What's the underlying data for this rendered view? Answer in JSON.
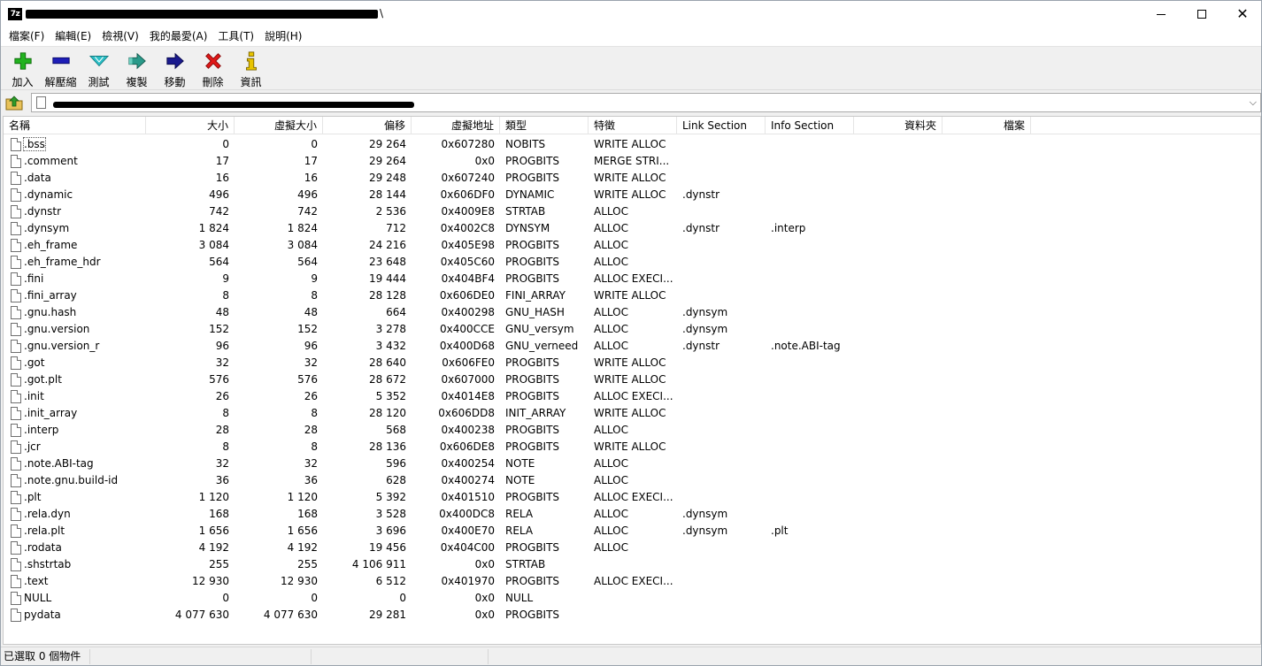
{
  "window": {
    "app_icon_text": "7z",
    "title_suffix": "\\"
  },
  "menu": [
    "檔案(F)",
    "編輯(E)",
    "檢視(V)",
    "我的最愛(A)",
    "工具(T)",
    "說明(H)"
  ],
  "toolbar": [
    {
      "id": "add",
      "label": "加入",
      "icon": "plus-icon",
      "color": "#22b21f"
    },
    {
      "id": "extract",
      "label": "解壓縮",
      "icon": "minus-icon",
      "color": "#1e1eb8"
    },
    {
      "id": "test",
      "label": "測試",
      "icon": "check-icon",
      "color": "#2bbfc6"
    },
    {
      "id": "copy",
      "label": "複製",
      "icon": "copy-arrow-icon",
      "color": "#2a9a8a"
    },
    {
      "id": "move",
      "label": "移動",
      "icon": "move-arrow-icon",
      "color": "#1a1a8e"
    },
    {
      "id": "delete",
      "label": "刪除",
      "icon": "delete-x-icon",
      "color": "#e01818"
    },
    {
      "id": "info",
      "label": "資訊",
      "icon": "info-icon",
      "color": "#c8a800"
    }
  ],
  "columns": [
    "名稱",
    "大小",
    "虛擬大小",
    "偏移",
    "虛擬地址",
    "類型",
    "特徵",
    "Link Section",
    "Info Section",
    "資料夾",
    "檔案"
  ],
  "rows": [
    [
      ".bss",
      "0",
      "0",
      "29 264",
      "0x607280",
      "NOBITS",
      "WRITE ALLOC",
      "",
      ""
    ],
    [
      ".comment",
      "17",
      "17",
      "29 264",
      "0x0",
      "PROGBITS",
      "MERGE STRI...",
      "",
      ""
    ],
    [
      ".data",
      "16",
      "16",
      "29 248",
      "0x607240",
      "PROGBITS",
      "WRITE ALLOC",
      "",
      ""
    ],
    [
      ".dynamic",
      "496",
      "496",
      "28 144",
      "0x606DF0",
      "DYNAMIC",
      "WRITE ALLOC",
      ".dynstr",
      ""
    ],
    [
      ".dynstr",
      "742",
      "742",
      "2 536",
      "0x4009E8",
      "STRTAB",
      "ALLOC",
      "",
      ""
    ],
    [
      ".dynsym",
      "1 824",
      "1 824",
      "712",
      "0x4002C8",
      "DYNSYM",
      "ALLOC",
      ".dynstr",
      ".interp"
    ],
    [
      ".eh_frame",
      "3 084",
      "3 084",
      "24 216",
      "0x405E98",
      "PROGBITS",
      "ALLOC",
      "",
      ""
    ],
    [
      ".eh_frame_hdr",
      "564",
      "564",
      "23 648",
      "0x405C60",
      "PROGBITS",
      "ALLOC",
      "",
      ""
    ],
    [
      ".fini",
      "9",
      "9",
      "19 444",
      "0x404BF4",
      "PROGBITS",
      "ALLOC EXECI...",
      "",
      ""
    ],
    [
      ".fini_array",
      "8",
      "8",
      "28 128",
      "0x606DE0",
      "FINI_ARRAY",
      "WRITE ALLOC",
      "",
      ""
    ],
    [
      ".gnu.hash",
      "48",
      "48",
      "664",
      "0x400298",
      "GNU_HASH",
      "ALLOC",
      ".dynsym",
      ""
    ],
    [
      ".gnu.version",
      "152",
      "152",
      "3 278",
      "0x400CCE",
      "GNU_versym",
      "ALLOC",
      ".dynsym",
      ""
    ],
    [
      ".gnu.version_r",
      "96",
      "96",
      "3 432",
      "0x400D68",
      "GNU_verneed",
      "ALLOC",
      ".dynstr",
      ".note.ABI-tag"
    ],
    [
      ".got",
      "32",
      "32",
      "28 640",
      "0x606FE0",
      "PROGBITS",
      "WRITE ALLOC",
      "",
      ""
    ],
    [
      ".got.plt",
      "576",
      "576",
      "28 672",
      "0x607000",
      "PROGBITS",
      "WRITE ALLOC",
      "",
      ""
    ],
    [
      ".init",
      "26",
      "26",
      "5 352",
      "0x4014E8",
      "PROGBITS",
      "ALLOC EXECI...",
      "",
      ""
    ],
    [
      ".init_array",
      "8",
      "8",
      "28 120",
      "0x606DD8",
      "INIT_ARRAY",
      "WRITE ALLOC",
      "",
      ""
    ],
    [
      ".interp",
      "28",
      "28",
      "568",
      "0x400238",
      "PROGBITS",
      "ALLOC",
      "",
      ""
    ],
    [
      ".jcr",
      "8",
      "8",
      "28 136",
      "0x606DE8",
      "PROGBITS",
      "WRITE ALLOC",
      "",
      ""
    ],
    [
      ".note.ABI-tag",
      "32",
      "32",
      "596",
      "0x400254",
      "NOTE",
      "ALLOC",
      "",
      ""
    ],
    [
      ".note.gnu.build-id",
      "36",
      "36",
      "628",
      "0x400274",
      "NOTE",
      "ALLOC",
      "",
      ""
    ],
    [
      ".plt",
      "1 120",
      "1 120",
      "5 392",
      "0x401510",
      "PROGBITS",
      "ALLOC EXECI...",
      "",
      ""
    ],
    [
      ".rela.dyn",
      "168",
      "168",
      "3 528",
      "0x400DC8",
      "RELA",
      "ALLOC",
      ".dynsym",
      ""
    ],
    [
      ".rela.plt",
      "1 656",
      "1 656",
      "3 696",
      "0x400E70",
      "RELA",
      "ALLOC",
      ".dynsym",
      ".plt"
    ],
    [
      ".rodata",
      "4 192",
      "4 192",
      "19 456",
      "0x404C00",
      "PROGBITS",
      "ALLOC",
      "",
      ""
    ],
    [
      ".shstrtab",
      "255",
      "255",
      "4 106 911",
      "0x0",
      "STRTAB",
      "",
      "",
      ""
    ],
    [
      ".text",
      "12 930",
      "12 930",
      "6 512",
      "0x401970",
      "PROGBITS",
      "ALLOC EXECI...",
      "",
      ""
    ],
    [
      "NULL",
      "0",
      "0",
      "0",
      "0x0",
      "NULL",
      "",
      "",
      ""
    ],
    [
      "pydata",
      "4 077 630",
      "4 077 630",
      "29 281",
      "0x0",
      "PROGBITS",
      "",
      "",
      ""
    ]
  ],
  "status": {
    "selected": "已選取 0 個物件"
  }
}
